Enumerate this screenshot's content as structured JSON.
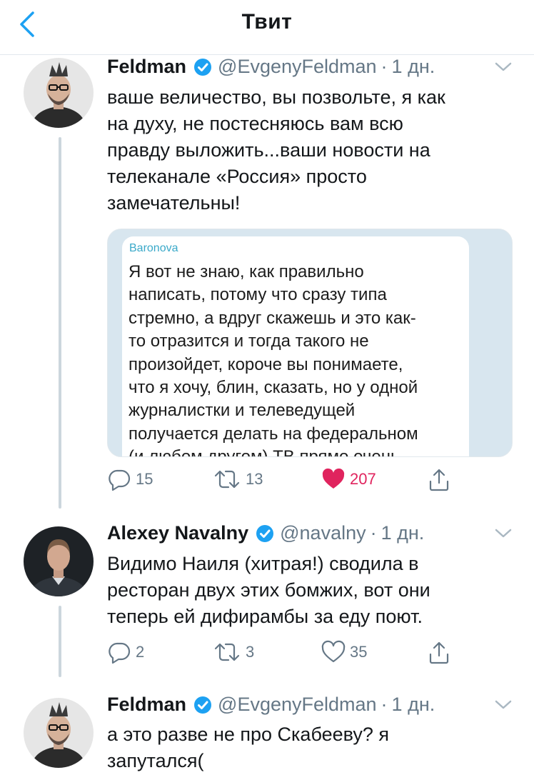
{
  "header": {
    "title": "Твит"
  },
  "colors": {
    "accent": "#1da1f2",
    "like": "#e0245e",
    "secondary": "#657786"
  },
  "tweets": [
    {
      "name": "Feldman",
      "handle": "@EvgenyFeldman",
      "separator": "·",
      "time": "1 дн.",
      "text": "ваше величество, вы позвольте, я как\nна духу, не постесняюсь вам всю\nправду выложить...ваши новости на\nтелеканале «Россия» просто\nзамечательны!",
      "media": {
        "author": "Baronova",
        "text": "Я вот не знаю, как правильно\nнаписать, потому что сразу типа\nстремно, а вдруг скажешь и это как-\nто отразится и тогда такого не\nпроизойдет, короче вы понимаете,\nчто я хочу, блин, сказать, но у одной\nжурналистки и телеведущей\nполучается делать на федеральном\n(и любом другом) ТВ прямо очень"
      },
      "replies": "15",
      "retweets": "13",
      "likes": "207",
      "liked": true
    },
    {
      "name": "Alexey Navalny",
      "handle": "@navalny",
      "separator": "·",
      "time": "1 дн.",
      "text": "Видимо Наиля (хитрая!) сводила в\nресторан двух этих бомжих, вот они\nтеперь ей дифирамбы за еду поют.",
      "replies": "2",
      "retweets": "3",
      "likes": "35",
      "liked": false
    },
    {
      "name": "Feldman",
      "handle": "@EvgenyFeldman",
      "separator": "·",
      "time": "1 дн.",
      "text": "а это разве не про Скабееву? я\nзапутался("
    }
  ]
}
